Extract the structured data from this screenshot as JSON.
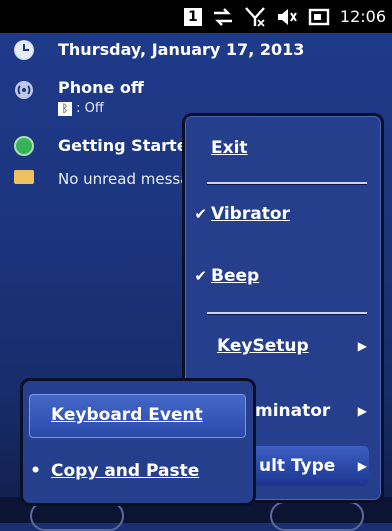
{
  "status_bar": {
    "badge": "1",
    "icons": [
      "sync-icon",
      "no-signal-icon",
      "speaker-muted-icon",
      "battery-icon"
    ],
    "time": "12:06"
  },
  "today": {
    "date": "Thursday, January 17, 2013",
    "phone_title": "Phone off",
    "phone_sub": ": Off",
    "getting_started": "Getting Starte",
    "messages": "No unread messa"
  },
  "main_menu": {
    "items": [
      {
        "label": "Exit",
        "check": "",
        "arrow": ""
      },
      {
        "label": "Vibrator",
        "check": "✔",
        "arrow": ""
      },
      {
        "label": "Beep",
        "check": "✔",
        "arrow": ""
      },
      {
        "label": "KeySetup",
        "check": "",
        "arrow": "▶"
      },
      {
        "label": "minator",
        "check": "",
        "arrow": "▶"
      },
      {
        "label": "ult Type",
        "check": "",
        "arrow": "▶"
      }
    ]
  },
  "sub_menu": {
    "items": [
      {
        "label": "Keyboard Event",
        "bullet": ""
      },
      {
        "label": "Copy and Paste",
        "bullet": "•"
      }
    ]
  },
  "colors": {
    "background": "#1c357f",
    "menu": "#253f8c",
    "highlight": "#3d5fc2",
    "text": "#ffffff"
  }
}
